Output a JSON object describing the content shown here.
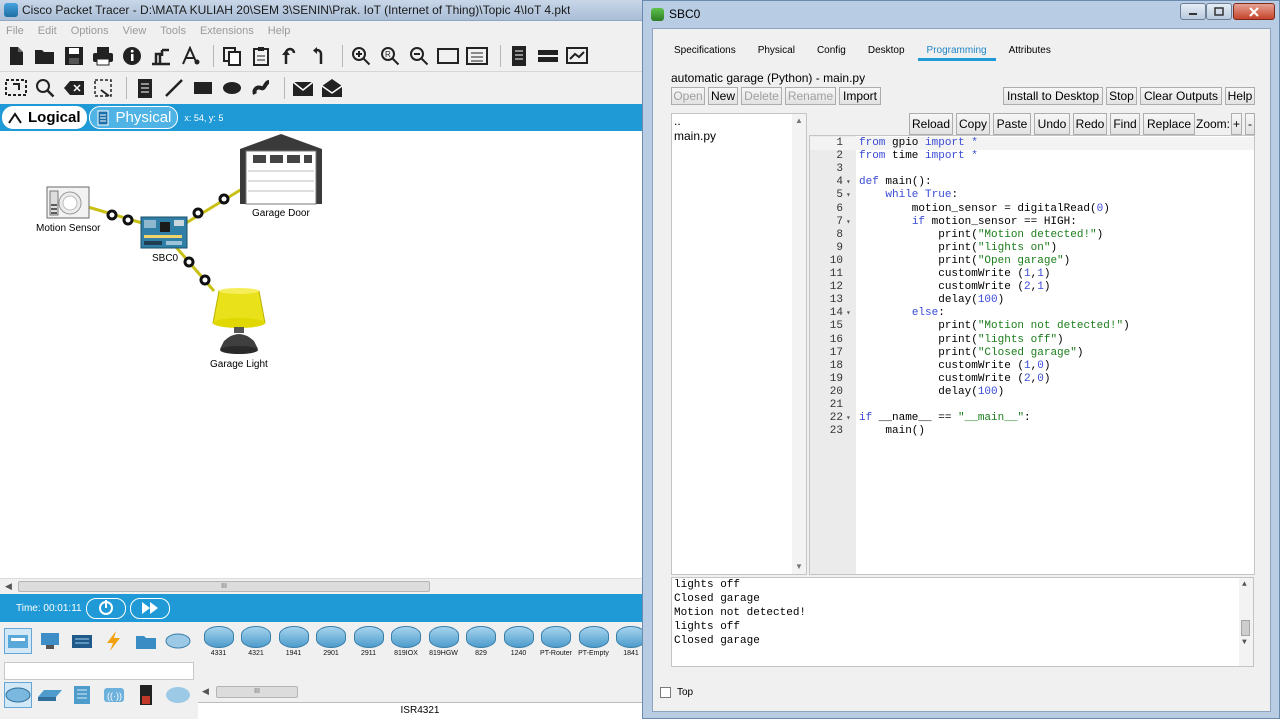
{
  "main_window": {
    "title": "Cisco Packet Tracer - D:\\MATA KULIAH 20\\SEM 3\\SENIN\\Prak. IoT (Internet of Thing)\\Topic 4\\IoT 4.pkt",
    "menu": [
      "File",
      "Edit",
      "Options",
      "View",
      "Tools",
      "Extensions",
      "Help"
    ],
    "toolbar1_icons": [
      "new-file-icon",
      "open-folder-icon",
      "save-icon",
      "print-icon",
      "info-icon",
      "network-wizard-icon",
      "activity-wizard-icon",
      "copy-icon",
      "paste-icon",
      "undo-icon",
      "redo-icon",
      "zoom-in-icon",
      "zoom-reset-icon",
      "zoom-out-icon",
      "drawing-palette-icon",
      "custom-device-icon",
      "viewport-icon",
      "cluster-icon",
      "screen-icon"
    ],
    "toolbar2_icons": [
      "select-icon",
      "inspect-icon",
      "delete-icon",
      "resize-icon",
      "note-icon",
      "line-icon",
      "rectangle-icon",
      "ellipse-icon",
      "freeform-icon",
      "add-pdu-icon",
      "add-complex-pdu-icon"
    ],
    "modes": {
      "logical": "Logical",
      "physical": "Physical",
      "coords": "x: 54, y: 5"
    },
    "devices": {
      "motion_sensor": "Motion Sensor",
      "sbc": "SBC0",
      "garage_door": "Garage Door",
      "garage_light": "Garage Light"
    },
    "time": "Time: 00:01:11",
    "device_models": [
      "4331",
      "4321",
      "1941",
      "2901",
      "2911",
      "819IOX",
      "819HGW",
      "829",
      "1240",
      "PT-Router",
      "PT-Empty",
      "1841"
    ],
    "selected_model": "ISR4321",
    "scroll_grip": "III"
  },
  "dialog": {
    "title": "SBC0",
    "tabs": [
      "Specifications",
      "Physical",
      "Config",
      "Desktop",
      "Programming",
      "Attributes"
    ],
    "active_tab": "Programming",
    "program_title": "automatic garage (Python) - main.py",
    "project_buttons": [
      "Open",
      "New",
      "Delete",
      "Rename",
      "Import"
    ],
    "run_buttons": [
      "Install to Desktop",
      "Stop",
      "Clear Outputs",
      "Help"
    ],
    "editor_buttons": [
      "Reload",
      "Copy",
      "Paste",
      "Undo",
      "Redo",
      "Find",
      "Replace"
    ],
    "zoom_label": "Zoom:",
    "zoom_in": "+",
    "zoom_out": "-",
    "files": [
      "..",
      "main.py"
    ],
    "code_lines": [
      "from gpio import *",
      "from time import *",
      "",
      "def main():",
      "    while True:",
      "        motion_sensor = digitalRead(0)",
      "        if motion_sensor == HIGH:",
      "            print(\"Motion detected!\")",
      "            print(\"lights on\")",
      "            print(\"Open garage\")",
      "            customWrite (1,1)",
      "            customWrite (2,1)",
      "            delay(100)",
      "        else:",
      "            print(\"Motion not detected!\")",
      "            print(\"lights off\")",
      "            print(\"Closed garage\")",
      "            customWrite (1,0)",
      "            customWrite (2,0)",
      "            delay(100)",
      "",
      "if __name__ == \"__main__\":",
      "    main()"
    ],
    "fold_lines": [
      4,
      5,
      7,
      14,
      22
    ],
    "output_lines": [
      "lights off",
      "Closed garage",
      "Motion not detected!",
      "lights off",
      "Closed garage"
    ],
    "top_checkbox": "Top"
  }
}
